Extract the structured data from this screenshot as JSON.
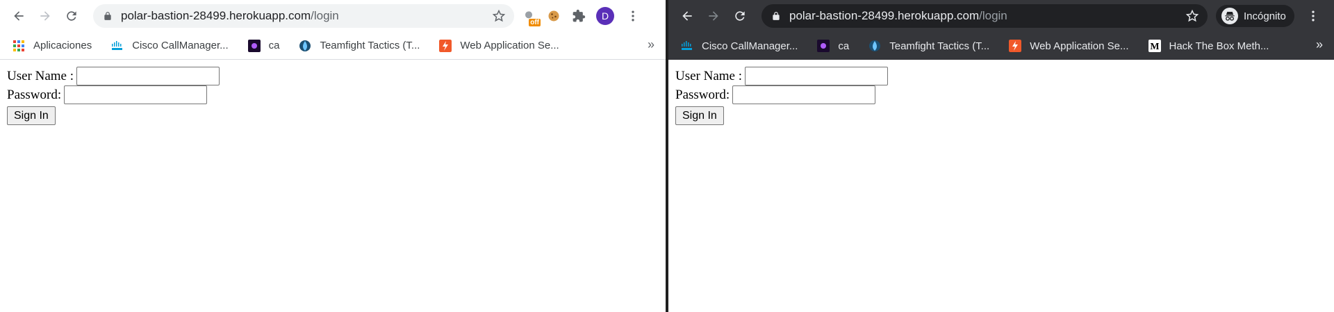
{
  "left_window": {
    "url_host": "polar-bastion-28499.herokuapp.com",
    "url_path": "/login",
    "extension_badge": "off",
    "avatar_letter": "D",
    "bookmarks": [
      {
        "label": "Aplicaciones",
        "icon": "apps-grid-icon"
      },
      {
        "label": "Cisco CallManager...",
        "icon": "cisco-icon"
      },
      {
        "label": "ca",
        "icon": "purple-badge-icon"
      },
      {
        "label": "Teamfight Tactics (T...",
        "icon": "drop-icon"
      },
      {
        "label": "Web Application Se...",
        "icon": "lightning-icon"
      }
    ],
    "more_bookmarks": "»"
  },
  "right_window": {
    "url_host": "polar-bastion-28499.herokuapp.com",
    "url_path": "/login",
    "incognito_label": "Incógnito",
    "bookmarks": [
      {
        "label": "Cisco CallManager...",
        "icon": "cisco-icon"
      },
      {
        "label": "ca",
        "icon": "purple-badge-icon"
      },
      {
        "label": "Teamfight Tactics (T...",
        "icon": "drop-icon"
      },
      {
        "label": "Web Application Se...",
        "icon": "lightning-icon"
      },
      {
        "label": "Hack The Box Meth...",
        "icon": "medium-m-icon"
      }
    ],
    "more_bookmarks": "»"
  },
  "login_form": {
    "username_label": "User Name :",
    "password_label": "Password:",
    "username_value": "",
    "password_value": "",
    "submit_label": "Sign In"
  },
  "colors": {
    "incognito_toolbar": "#35363a",
    "avatar": "#5a2fb8",
    "cisco": "#049fd9",
    "lightning": "#f1592a"
  }
}
